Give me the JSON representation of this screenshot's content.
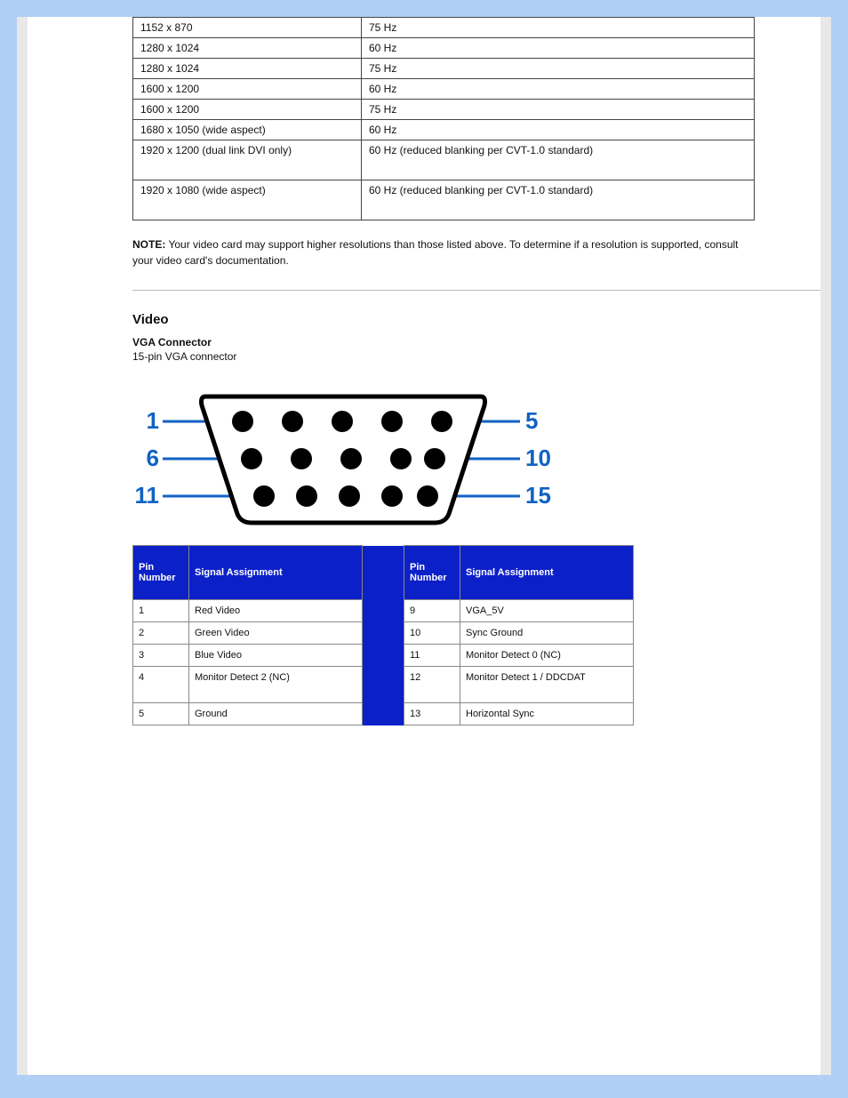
{
  "outer_table": {
    "rows": [
      {
        "c1": "1152 x 870",
        "c2": "75 Hz"
      },
      {
        "c1": "1280 x 1024",
        "c2": "60 Hz"
      },
      {
        "c1": "1280 x 1024",
        "c2": "75 Hz"
      },
      {
        "c1": "1600 x 1200",
        "c2": "60 Hz"
      },
      {
        "c1": "1600 x 1200",
        "c2": "75 Hz"
      },
      {
        "c1": "1680 x 1050 (wide aspect)",
        "c2": "60 Hz"
      },
      {
        "c1": "1920 x 1200 (dual link DVI only)",
        "c2": "60 Hz (reduced blanking per CVT-1.0 standard)"
      },
      {
        "c1": "1920 x 1080 (wide aspect)",
        "c2": "60 Hz (reduced blanking per CVT-1.0 standard)"
      }
    ]
  },
  "note_label": "NOTE:",
  "note_text": "Your video card may support higher resolutions than those listed above. To determine if a resolution is supported, consult your video card's documentation.",
  "section_title": "Video",
  "sub_title": "VGA Connector",
  "sub_text": "15-pin VGA connector",
  "conn_labels": {
    "p1": "1",
    "p5": "5",
    "p6": "6",
    "p10": "10",
    "p11": "11",
    "p15": "15"
  },
  "pin_header": {
    "num": "Pin Number",
    "sig": "Signal Assignment"
  },
  "pin_left": [
    {
      "n": "1",
      "s": "Red Video"
    },
    {
      "n": "2",
      "s": "Green Video"
    },
    {
      "n": "3",
      "s": "Blue Video"
    },
    {
      "n": "4",
      "s": "Monitor Detect 2 (NC)"
    },
    {
      "n": "5",
      "s": "Ground"
    }
  ],
  "pin_right": [
    {
      "n": "9",
      "s": "VGA_5V"
    },
    {
      "n": "10",
      "s": "Sync Ground"
    },
    {
      "n": "11",
      "s": "Monitor Detect 0 (NC)"
    },
    {
      "n": "12",
      "s": "Monitor Detect 1 / DDCDAT"
    },
    {
      "n": "13",
      "s": "Horizontal Sync"
    }
  ]
}
